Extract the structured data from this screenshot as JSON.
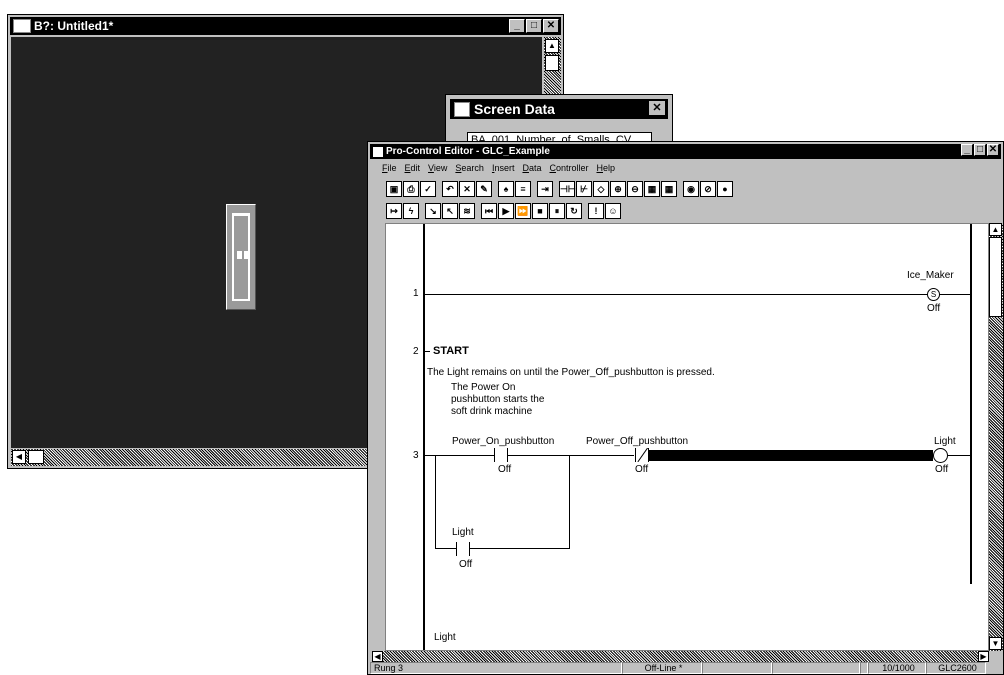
{
  "screen_window": {
    "title": "B?: Untitled1*"
  },
  "screen_data": {
    "title": "Screen Data",
    "field_value": "BA_001_Number_of_Smalls_CV"
  },
  "editor": {
    "title": "Pro-Control Editor - GLC_Example",
    "menu": [
      "File",
      "Edit",
      "View",
      "Search",
      "Insert",
      "Data",
      "Controller",
      "Help"
    ],
    "rungs": {
      "r1_num": "1",
      "r1_coil": "Ice_Maker",
      "r1_coil_state": "Off",
      "r2_num": "2",
      "r2_label": "START",
      "r2_comment": "The Light remains on until the Power_Off_pushbutton is pressed.",
      "r2_note_1": "The Power On",
      "r2_note_2": "pushbutton starts the",
      "r2_note_3": "soft drink machine",
      "r3_num": "3",
      "r3_contact1": "Power_On_pushbutton",
      "r3_contact1_state": "Off",
      "r3_contact2": "Power_Off_pushbutton",
      "r3_contact2_state": "Off",
      "r3_coil": "Light",
      "r3_coil_state": "Off",
      "r3_branch": "Light",
      "r3_branch_state": "Off",
      "r4_label": "Light"
    },
    "status": {
      "rung": "Rung 3",
      "mode": "Off-Line *",
      "count": "10/1000",
      "device": "GLC2600"
    }
  }
}
